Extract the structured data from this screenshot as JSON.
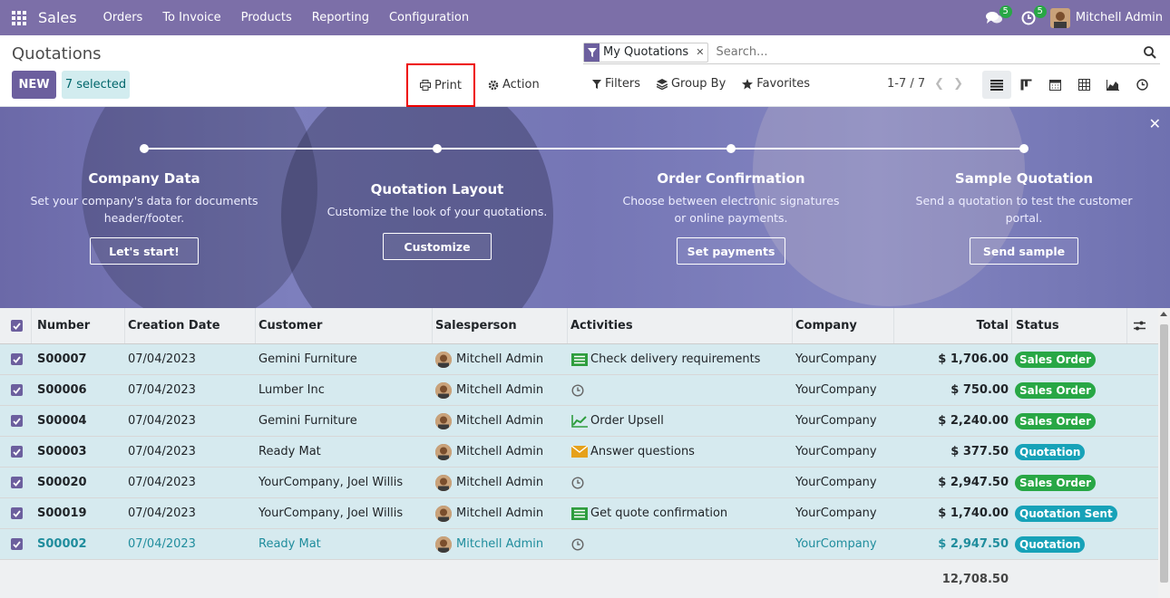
{
  "nav": {
    "app_name": "Sales",
    "menu": [
      "Orders",
      "To Invoice",
      "Products",
      "Reporting",
      "Configuration"
    ],
    "messages_count": "5",
    "activities_count": "5",
    "user_name": "Mitchell Admin"
  },
  "control_panel": {
    "breadcrumb": "Quotations",
    "new_label": "NEW",
    "selected_label": "7 selected",
    "print_label": "Print",
    "action_label": "Action",
    "search_facet": "My Quotations",
    "search_placeholder": "Search...",
    "filters_label": "Filters",
    "groupby_label": "Group By",
    "favorites_label": "Favorites",
    "pager": "1-7 / 7",
    "views": [
      "list-view-icon",
      "kanban-view-icon",
      "calendar-view-icon",
      "pivot-view-icon",
      "graph-view-icon",
      "activity-view-icon"
    ]
  },
  "onboarding": {
    "steps": [
      {
        "title": "Company Data",
        "desc1": "Set your company's data for documents",
        "desc2": "header/footer.",
        "button": "Let's start!"
      },
      {
        "title": "Quotation Layout",
        "desc1": "Customize the look of your quotations.",
        "desc2": "",
        "button": "Customize"
      },
      {
        "title": "Order Confirmation",
        "desc1": "Choose between electronic signatures",
        "desc2": "or online payments.",
        "button": "Set payments"
      },
      {
        "title": "Sample Quotation",
        "desc1": "Send a quotation to test the customer",
        "desc2": "portal.",
        "button": "Send sample"
      }
    ]
  },
  "table": {
    "columns": [
      "Number",
      "Creation Date",
      "Customer",
      "Salesperson",
      "Activities",
      "Company",
      "Total",
      "Status"
    ],
    "rows": [
      {
        "number": "S00007",
        "date": "07/04/2023",
        "customer": "Gemini Furniture",
        "salesperson": "Mitchell Admin",
        "activity_icon": "todo",
        "activity": "Check delivery requirements",
        "company": "YourCompany",
        "total": "$ 1,706.00",
        "status": "Sales Order",
        "status_type": "so"
      },
      {
        "number": "S00006",
        "date": "07/04/2023",
        "customer": "Lumber Inc",
        "salesperson": "Mitchell Admin",
        "activity_icon": "clock",
        "activity": "",
        "company": "YourCompany",
        "total": "$ 750.00",
        "status": "Sales Order",
        "status_type": "so"
      },
      {
        "number": "S00004",
        "date": "07/04/2023",
        "customer": "Gemini Furniture",
        "salesperson": "Mitchell Admin",
        "activity_icon": "upsell",
        "activity": "Order Upsell",
        "company": "YourCompany",
        "total": "$ 2,240.00",
        "status": "Sales Order",
        "status_type": "so"
      },
      {
        "number": "S00003",
        "date": "07/04/2023",
        "customer": "Ready Mat",
        "salesperson": "Mitchell Admin",
        "activity_icon": "email",
        "activity": "Answer questions",
        "company": "YourCompany",
        "total": "$ 377.50",
        "status": "Quotation",
        "status_type": "q"
      },
      {
        "number": "S00020",
        "date": "07/04/2023",
        "customer": "YourCompany, Joel Willis",
        "salesperson": "Mitchell Admin",
        "activity_icon": "clock",
        "activity": "",
        "company": "YourCompany",
        "total": "$ 2,947.50",
        "status": "Sales Order",
        "status_type": "so"
      },
      {
        "number": "S00019",
        "date": "07/04/2023",
        "customer": "YourCompany, Joel Willis",
        "salesperson": "Mitchell Admin",
        "activity_icon": "todo",
        "activity": "Get quote confirmation",
        "company": "YourCompany",
        "total": "$ 1,740.00",
        "status": "Quotation Sent",
        "status_type": "q"
      },
      {
        "number": "S00002",
        "date": "07/04/2023",
        "customer": "Ready Mat",
        "salesperson": "Mitchell Admin",
        "activity_icon": "clock",
        "activity": "",
        "company": "YourCompany",
        "total": "$ 2,947.50",
        "status": "Quotation",
        "status_type": "q",
        "highlight": true
      }
    ],
    "grand_total": "12,708.50"
  },
  "colors": {
    "nav": "#7c6fa8",
    "primary": "#6c5f9e",
    "sales_order": "#28a745",
    "quotation": "#17a2b8",
    "row_selected": "#d6eaef"
  }
}
